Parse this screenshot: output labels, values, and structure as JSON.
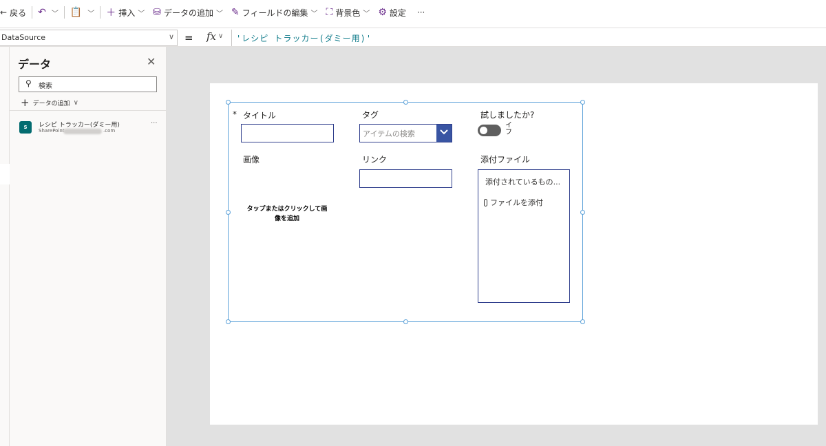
{
  "toolbar": {
    "back_label": "戻る",
    "insert_label": "挿入",
    "add_data_label": "データの追加",
    "edit_fields_label": "フィールドの編集",
    "background_label": "背景色",
    "settings_label": "設定",
    "more_label": "···"
  },
  "formula_bar": {
    "property": "DataSource",
    "equals": "=",
    "fx": "fx",
    "formula": "'レシピ トラッカー(ダミー用)'"
  },
  "data_panel": {
    "title": "データ",
    "search_placeholder": "検索",
    "add_data_label": "データの追加",
    "items": [
      {
        "name": "レシピ トラッカー(ダミー用)",
        "source_prefix": "SharePoint",
        "source_suffix": ".com",
        "icon": "sharepoint-icon",
        "icon_text": "S"
      }
    ]
  },
  "form": {
    "required_marker": "*",
    "fields": {
      "title": {
        "label": "タイトル",
        "value": ""
      },
      "tag": {
        "label": "タグ",
        "placeholder": "アイテムの検索"
      },
      "tried": {
        "label": "試しましたか?",
        "toggle_text": "イ\nフ",
        "on": false
      },
      "image": {
        "label": "画像",
        "hint_line1": "タップまたはクリックして画",
        "hint_line2": "像を追加"
      },
      "link": {
        "label": "リンク",
        "value": ""
      },
      "attachments": {
        "label": "添付ファイル",
        "empty_text": "添付されているもの...",
        "add_label": "ファイルを添付"
      }
    }
  },
  "colors": {
    "accent": "#6b2d8c",
    "input_border": "#2f3e8c",
    "selection": "#5aa0d8",
    "combo_button": "#3955a3",
    "sharepoint": "#036c70"
  }
}
